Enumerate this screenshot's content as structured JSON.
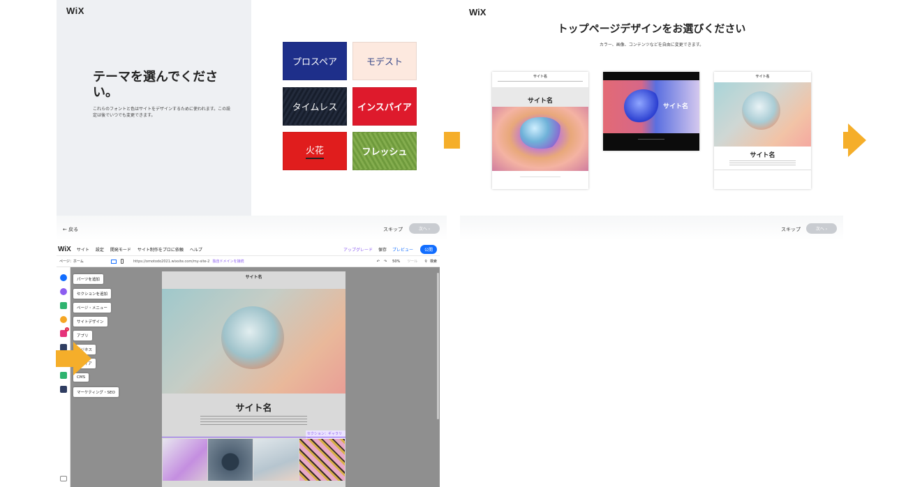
{
  "panel1": {
    "logo": "WiX",
    "title": "テーマを選んでください。",
    "description": "これらのフォントと色はサイトをデザインするために使われます。この設定は後でいつでも変更できます。",
    "themes": [
      {
        "label": "プロスペア",
        "color": "#1e2f8a"
      },
      {
        "label": "モデスト",
        "color": "#fde9df"
      },
      {
        "label": "タイムレス",
        "color": "#171e2c"
      },
      {
        "label": "インスパイア",
        "color": "#de1a2c"
      },
      {
        "label": "火花",
        "color": "#e01d1d"
      },
      {
        "label": "フレッシュ",
        "color": "#6e9a3c"
      }
    ],
    "back": "← 戻る",
    "skip": "スキップ",
    "next": "次へ ›"
  },
  "panel2": {
    "logo": "WiX",
    "heading": "トップページデザインをお選びください",
    "subheading": "カラー、画像、コンテンツなどを自由に変更できます。",
    "cards": [
      {
        "site_name_top": "サイト名",
        "site_name": "サイト名"
      },
      {
        "site_name": "サイト名"
      },
      {
        "site_name_top": "サイト名",
        "site_name": "サイト名"
      }
    ],
    "skip": "スキップ",
    "next": "次へ ›"
  },
  "panel3": {
    "logo": "WiX",
    "menu": [
      "サイト",
      "設定",
      "開発モード",
      "サイト制作をプロに依頼",
      "ヘルプ"
    ],
    "actions": {
      "upgrade": "アップグレード",
      "save": "保存",
      "preview": "プレビュー",
      "publish": "公開"
    },
    "page_select": "ページ：ホーム",
    "url": "https://omotodo2021.wixsite.com/my-site-2",
    "connect_domain": "独自ドメインを接続",
    "zoom": "50%",
    "tools": "ツール",
    "search": "検索",
    "sidebar_menu": [
      "パーツを追加",
      "セクションを追加",
      "ページ・メニュー",
      "サイトデザイン",
      "アプリ",
      "ビジネス",
      "メディア",
      "CMS",
      "マーケティング・SEO"
    ],
    "page_site_name_top": "サイト名",
    "page_site_name": "サイト名",
    "section_label": "セクション：ギャラリー",
    "badge": "1"
  },
  "colors": {
    "arrow": "#f5ae2a",
    "publish": "#116dff",
    "upgrade": "#8c5df0"
  },
  "icons": [
    "arrow-right-icon",
    "desktop-icon",
    "mobile-icon",
    "undo-icon",
    "redo-icon",
    "search-icon",
    "add-icon"
  ]
}
